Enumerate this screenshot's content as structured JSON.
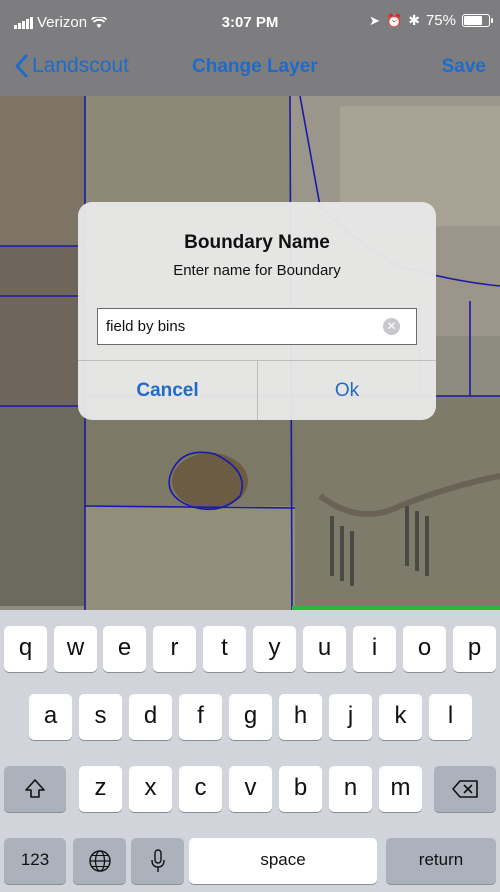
{
  "status_bar": {
    "carrier": "Verizon",
    "time": "3:07 PM",
    "battery": "75%",
    "icons": [
      "signal-icon",
      "wifi-icon",
      "location-arrow-icon",
      "alarm-icon",
      "bluetooth-icon",
      "battery-icon"
    ]
  },
  "nav": {
    "back_label": "Landscout",
    "center_label": "Change Layer",
    "save_label": "Save"
  },
  "dialog": {
    "title": "Boundary Name",
    "message": "Enter name for Boundary",
    "input_value": "field by bins",
    "cancel_label": "Cancel",
    "ok_label": "Ok"
  },
  "keyboard": {
    "row1": [
      "q",
      "w",
      "e",
      "r",
      "t",
      "y",
      "u",
      "i",
      "o",
      "p"
    ],
    "row2": [
      "a",
      "s",
      "d",
      "f",
      "g",
      "h",
      "j",
      "k",
      "l"
    ],
    "row3": [
      "z",
      "x",
      "c",
      "v",
      "b",
      "n",
      "m"
    ],
    "numbers_label": "123",
    "space_label": "space",
    "return_label": "return"
  },
  "colors": {
    "accent": "#1f6bc9",
    "boundary_lines": "#1a1aa8",
    "map_status_strip": "#2fb53a"
  }
}
